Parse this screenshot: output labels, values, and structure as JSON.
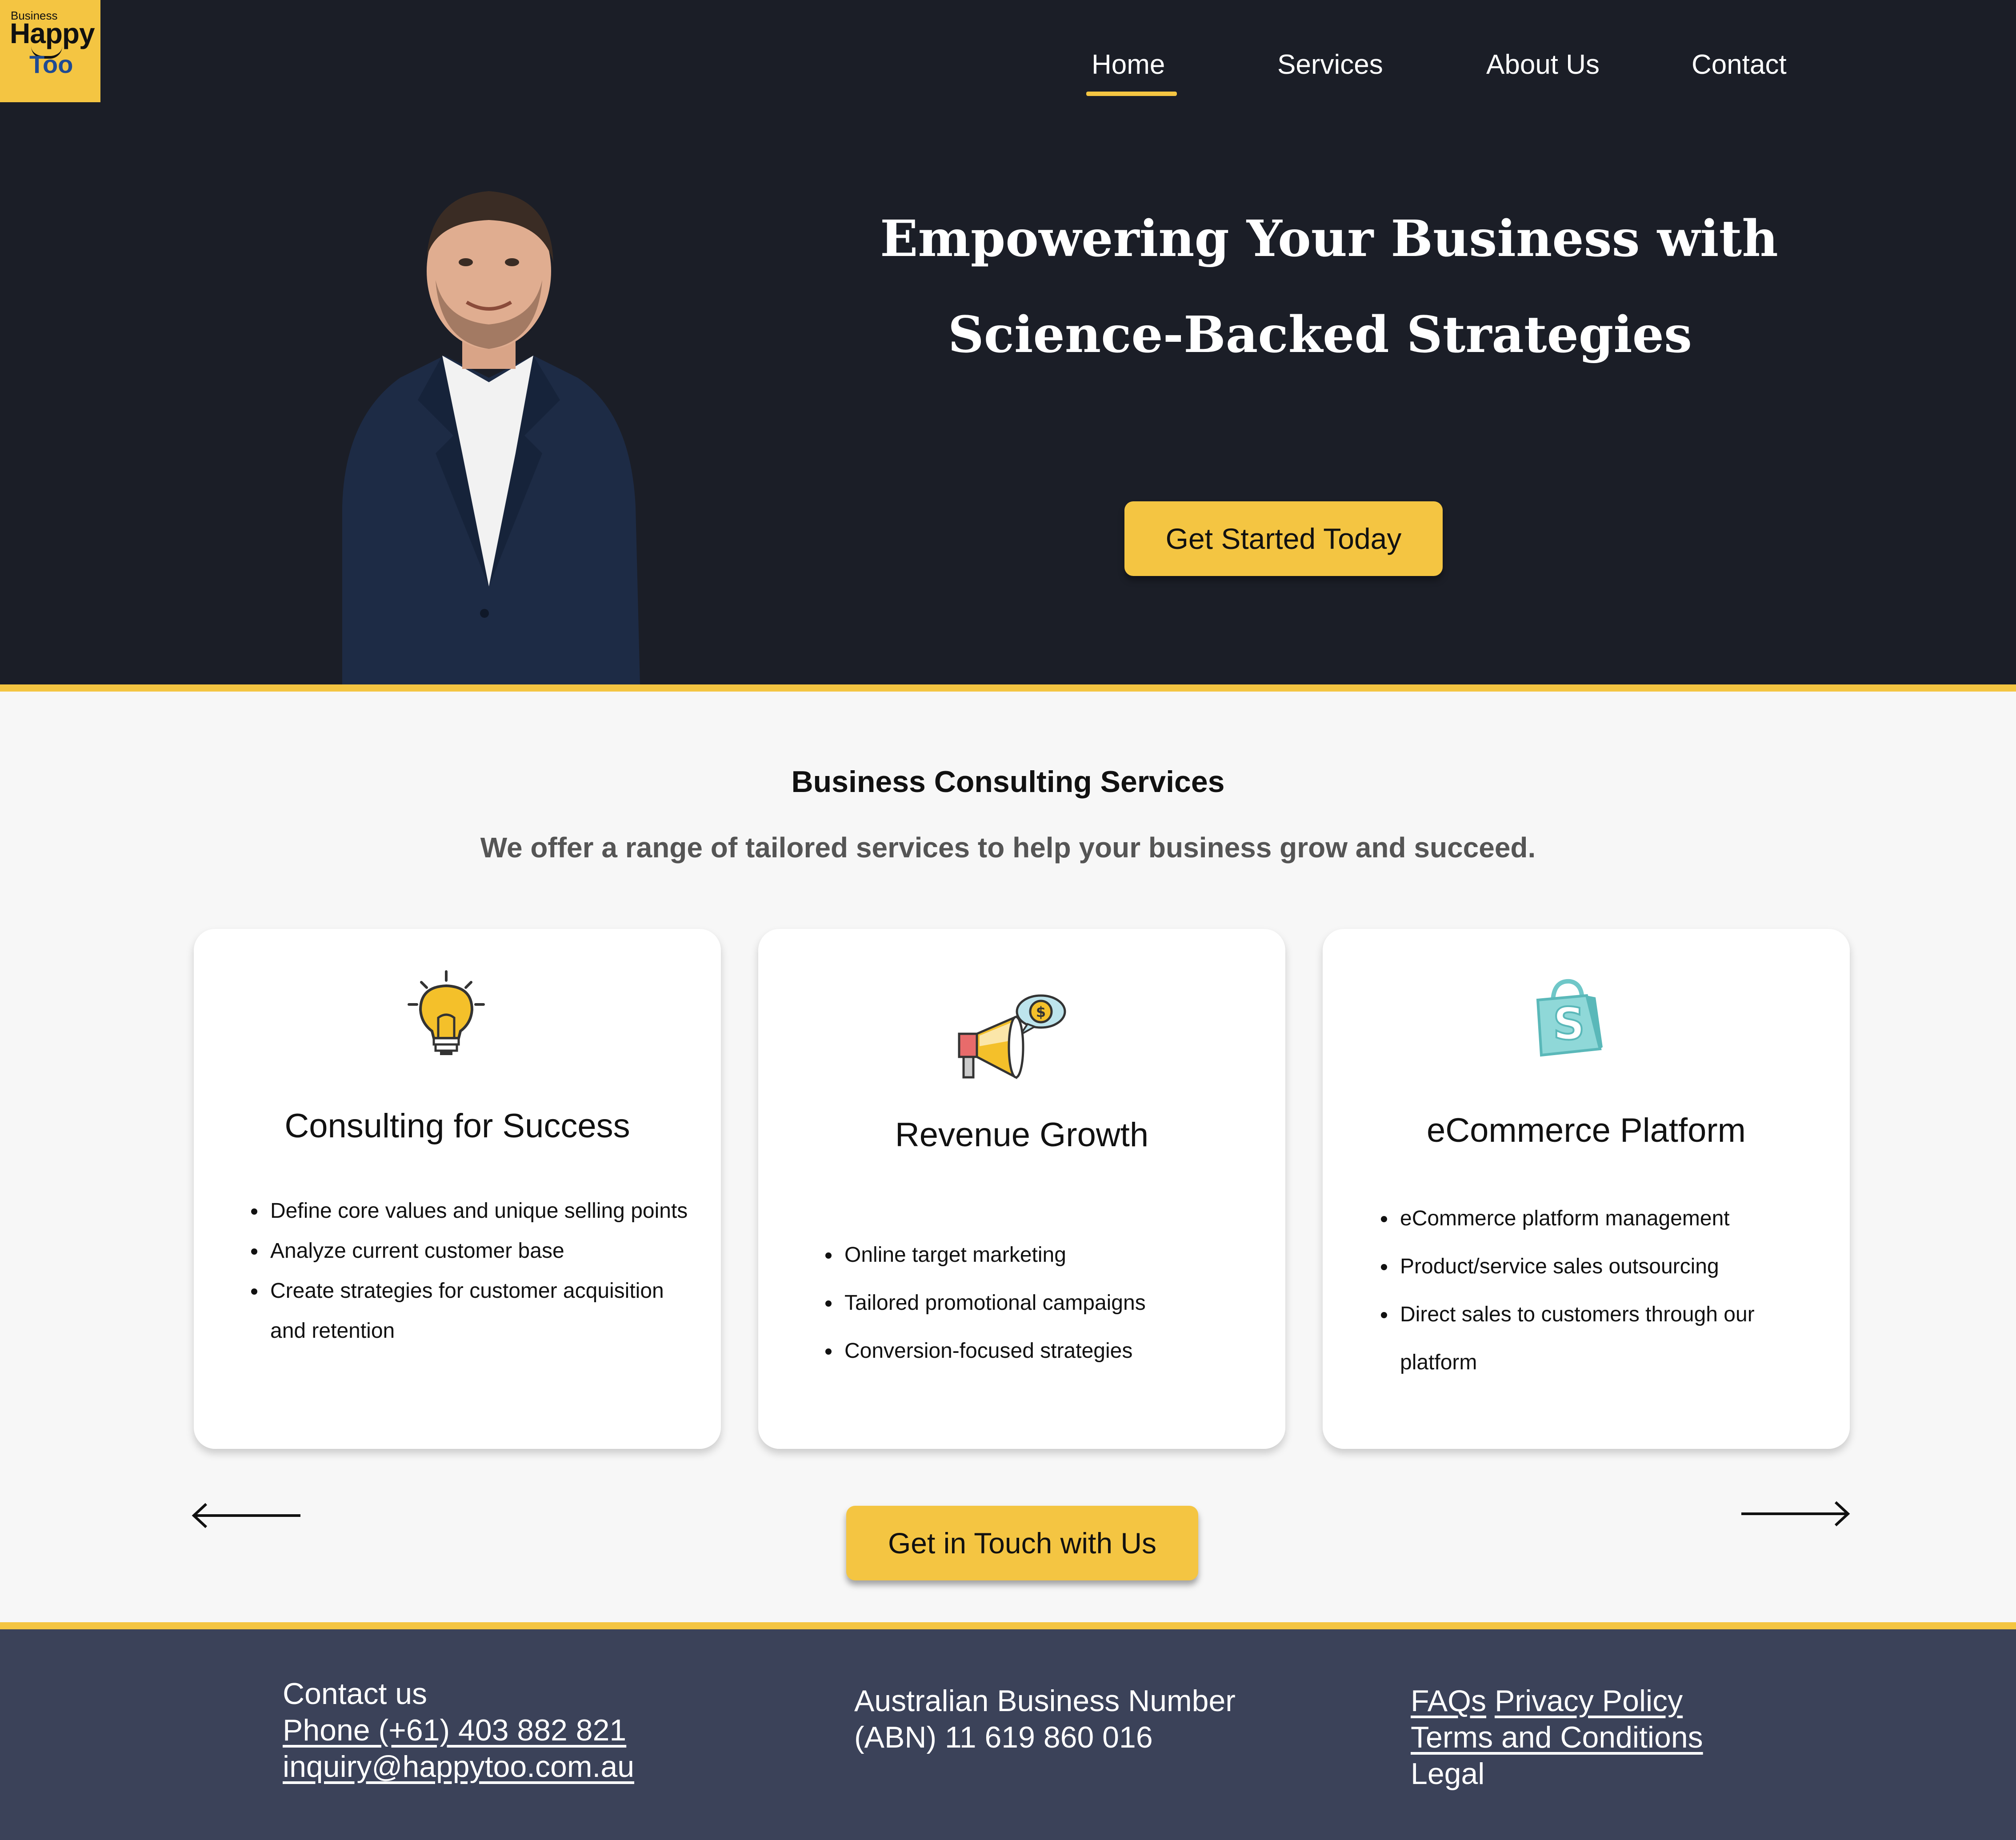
{
  "logo": {
    "small": "Business",
    "line1": "Happy",
    "line2": "Too"
  },
  "nav": {
    "home": "Home",
    "services": "Services",
    "about": "About Us",
    "contact": "Contact"
  },
  "hero": {
    "title_line1": "Empowering Your Business with",
    "title_line2": "Science-Backed Strategies",
    "cta": "Get Started Today"
  },
  "services": {
    "title": "Business Consulting Services",
    "subtitle": "We offer a range of tailored services to help your business grow and succeed.",
    "cards": [
      {
        "icon": "lightbulb-icon",
        "title": "Consulting for Success",
        "items": [
          "Define core values and unique selling points",
          "Analyze current customer base",
          "Create strategies for customer acquisition and retention"
        ]
      },
      {
        "icon": "megaphone-icon",
        "title": "Revenue Growth",
        "items": [
          "Online target marketing",
          "Tailored promotional campaigns",
          "Conversion-focused strategies"
        ]
      },
      {
        "icon": "shopping-bag-icon",
        "title": "eCommerce Platform",
        "items": [
          "eCommerce platform management",
          "Product/service sales outsourcing",
          "Direct sales to customers through our platform"
        ]
      }
    ],
    "cta": "Get in Touch with Us"
  },
  "footer": {
    "contact_heading": "Contact us",
    "phone": "Phone (+61) 403 882 821",
    "email": "inquiry@happytoo.com.au",
    "abn_line1": "Australian Business Number",
    "abn_line2": "(ABN) 11 619 860 016",
    "faqs": "FAQs",
    "privacy": "Privacy Policy",
    "terms": "Terms and Conditions",
    "legal": "Legal"
  },
  "colors": {
    "navy": "#1b1e27",
    "accent": "#f4c542",
    "footer": "#3b4259"
  }
}
